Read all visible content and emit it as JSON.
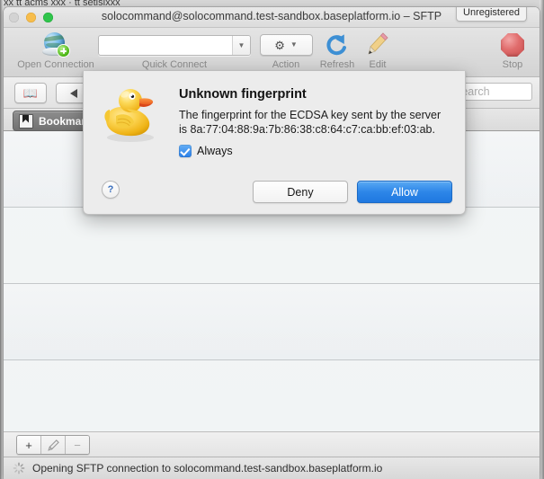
{
  "background_window": {
    "clipped_text": "xx tt acms  xxx · tt setislxxx"
  },
  "window": {
    "title": "solocommand@solocommand.test-sandbox.baseplatform.io – SFTP",
    "badge": "Unregistered",
    "traffic_lights": {
      "close": "close-button",
      "minimize": "minimize-button",
      "maximize": "maximize-button"
    }
  },
  "toolbar": {
    "items": [
      {
        "label": "Open Connection",
        "icon": "globe-add-icon"
      },
      {
        "label": "Quick Connect",
        "icon": "combo-box"
      },
      {
        "label": "Action",
        "icon": "gear-icon"
      },
      {
        "label": "Refresh",
        "icon": "refresh-arrow-icon"
      },
      {
        "label": "Edit",
        "icon": "pencil-icon"
      },
      {
        "label": "Stop",
        "icon": "stop-octagon-icon"
      }
    ],
    "quick_connect": {
      "value": "",
      "placeholder": ""
    }
  },
  "navbar": {
    "bookmarks_toggle_icon": "open-book-icon",
    "back_icon": "back-triangle-icon",
    "search": {
      "value": "",
      "placeholder": "Search"
    }
  },
  "tabstrip": {
    "active_tab": "Bookmarks",
    "tab_icon": "bookmark-ribbon-icon"
  },
  "bookmark_list": {
    "rows": [
      "",
      "",
      "",
      ""
    ]
  },
  "bottom_bar": {
    "buttons": [
      {
        "label": "+",
        "name": "add-bookmark-button",
        "enabled": true
      },
      {
        "label": "",
        "name": "edit-bookmark-button",
        "enabled": false
      },
      {
        "label": "−",
        "name": "remove-bookmark-button",
        "enabled": false
      }
    ]
  },
  "statusbar": {
    "spinner_icon": "loading-spinner-icon",
    "text": "Opening SFTP connection to solocommand.test-sandbox.baseplatform.io"
  },
  "dialog": {
    "icon": "rubber-duck-icon",
    "title": "Unknown fingerprint",
    "body": "The fingerprint for the ECDSA key sent by the server is 8a:77:04:88:9a:7b:86:38:c8:64:c7:ca:bb:ef:03:ab.",
    "checkbox": {
      "label": "Always",
      "checked": true
    },
    "help_label": "?",
    "deny_label": "Deny",
    "allow_label": "Allow"
  },
  "colors": {
    "accent_blue": "#2d86e8",
    "checkbox_blue": "#2a7fe8",
    "stop_red": "#d96b6b",
    "duck_yellow": "#f2c227",
    "window_chrome": "#ececec"
  }
}
